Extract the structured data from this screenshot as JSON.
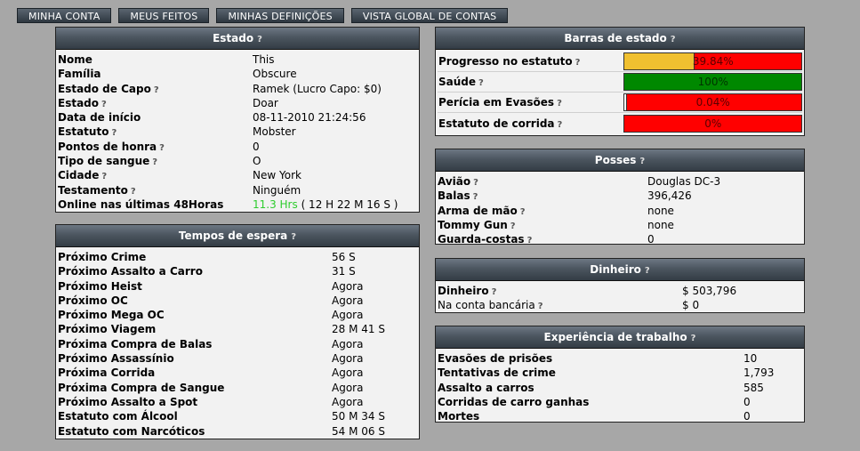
{
  "tabs": [
    "MINHA CONTA",
    "MEUS FEITOS",
    "MINHAS DEFINIÇÕES",
    "VISTA GLOBAL DE CONTAS"
  ],
  "help_glyph": "?",
  "estado": {
    "title": "Estado",
    "rows": [
      {
        "label": "Nome",
        "value": "This"
      },
      {
        "label": "Família",
        "value": "Obscure"
      },
      {
        "label": "Estado de Capo",
        "value": "Ramek (Lucro Capo: $0)"
      },
      {
        "label": "Estado",
        "value": "Doar"
      },
      {
        "label": "Data de início",
        "value": "08-11-2010 21:24:56"
      },
      {
        "label": "Estatuto",
        "value": "Mobster"
      },
      {
        "label": "Pontos de honra",
        "value": "0"
      },
      {
        "label": "Tipo de sangue",
        "value": "O"
      },
      {
        "label": "Cidade",
        "value": "New York"
      },
      {
        "label": "Testamento",
        "value": "Ninguém"
      }
    ],
    "online_label": "Online nas últimas 48Horas",
    "online_hours": "11.3 Hrs",
    "online_detail": " ( 12 H 22 M 16 S )"
  },
  "tempos": {
    "title": "Tempos de espera",
    "rows": [
      {
        "label": "Próximo Crime",
        "value": "56 S"
      },
      {
        "label": "Próximo Assalto a Carro",
        "value": "31 S"
      },
      {
        "label": "Próximo Heist",
        "value": "Agora"
      },
      {
        "label": "Próximo OC",
        "value": "Agora"
      },
      {
        "label": "Próximo Mega OC",
        "value": "Agora"
      },
      {
        "label": "Próximo Viagem",
        "value": "28 M 41 S"
      },
      {
        "label": "Próxima Compra de Balas",
        "value": "Agora"
      },
      {
        "label": "Próximo Assassínio",
        "value": "Agora"
      },
      {
        "label": "Próxima Corrida",
        "value": "Agora"
      },
      {
        "label": "Próxima Compra de Sangue",
        "value": "Agora"
      },
      {
        "label": "Próximo Assalto a Spot",
        "value": "Agora"
      },
      {
        "label": "Estatuto com Álcool",
        "value": "50 M 34 S"
      },
      {
        "label": "Estatuto com Narcóticos",
        "value": "54 M 06 S"
      }
    ]
  },
  "barras": {
    "title": "Barras de estado",
    "rows": [
      {
        "label": "Progresso no estatuto",
        "text": "39.84%",
        "fraction": 0.3984,
        "fill_color": "#f0c030"
      },
      {
        "label": "Saúde",
        "text": "100%",
        "fraction": 1.0,
        "fill_color": "#008800"
      },
      {
        "label": "Perícia em Evasões",
        "text": "0.04%",
        "fraction": 0.0004,
        "fill_color": "#ffffff"
      },
      {
        "label": "Estatuto de corrida",
        "text": "0%",
        "fraction": 0.0,
        "fill_color": "#ffffff"
      }
    ]
  },
  "posses": {
    "title": "Posses",
    "rows": [
      {
        "label": "Avião",
        "value": "Douglas DC-3"
      },
      {
        "label": "Balas",
        "value": "396,426"
      },
      {
        "label": "Arma de mão",
        "value": "none"
      },
      {
        "label": "Tommy Gun",
        "value": "none"
      },
      {
        "label": "Guarda-costas",
        "value": "0"
      }
    ]
  },
  "dinheiro": {
    "title": "Dinheiro",
    "rows": [
      {
        "label": "Dinheiro",
        "value": "$ 503,796",
        "bold": true
      },
      {
        "label": "Na conta bancária",
        "value": "$ 0",
        "bold": false
      }
    ]
  },
  "experiencia": {
    "title": "Experiência de trabalho",
    "rows": [
      {
        "label": "Evasões de prisões",
        "value": "10"
      },
      {
        "label": "Tentativas de crime",
        "value": "1,793"
      },
      {
        "label": "Assalto a carros",
        "value": "585"
      },
      {
        "label": "Corridas de carro ganhas",
        "value": "0"
      },
      {
        "label": "Mortes",
        "value": "0"
      }
    ]
  }
}
